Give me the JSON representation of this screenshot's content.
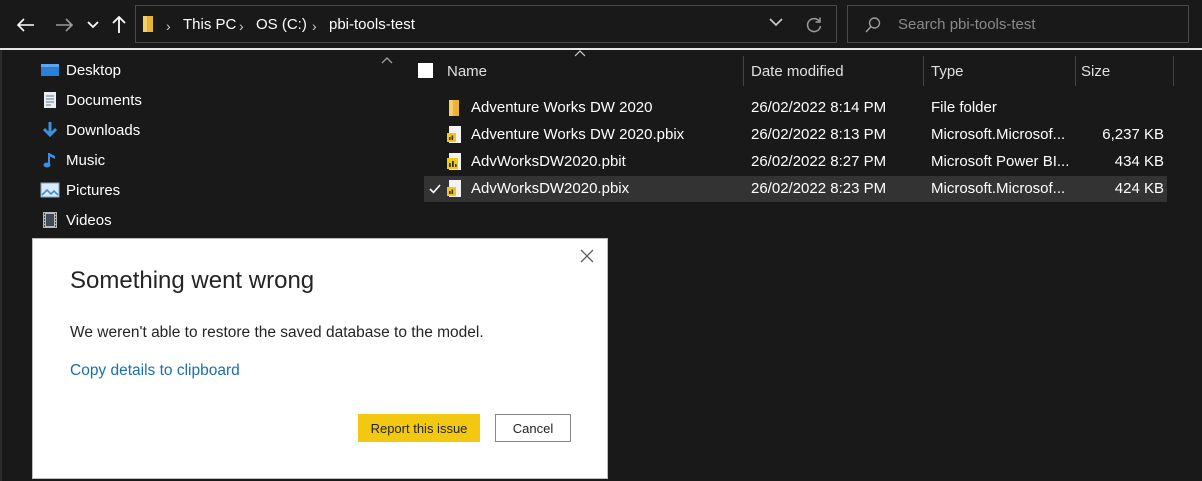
{
  "address_bar": {
    "crumbs": [
      "This PC",
      "OS (C:)",
      "pbi-tools-test"
    ],
    "search_placeholder": "Search pbi-tools-test"
  },
  "sidebar": {
    "items": [
      {
        "label": "Desktop",
        "icon": "desktop-icon"
      },
      {
        "label": "Documents",
        "icon": "documents-icon"
      },
      {
        "label": "Downloads",
        "icon": "downloads-icon"
      },
      {
        "label": "Music",
        "icon": "music-icon"
      },
      {
        "label": "Pictures",
        "icon": "pictures-icon"
      },
      {
        "label": "Videos",
        "icon": "videos-icon"
      }
    ]
  },
  "file_list": {
    "columns": [
      "Name",
      "Date modified",
      "Type",
      "Size"
    ],
    "rows": [
      {
        "name": "Adventure Works DW 2020",
        "date": "26/02/2022 8:14 PM",
        "type": "File folder",
        "size": "",
        "icon": "folder-icon",
        "selected": false
      },
      {
        "name": "Adventure Works DW 2020.pbix",
        "date": "26/02/2022 8:13 PM",
        "type": "Microsoft.Microsof...",
        "size": "6,237 KB",
        "icon": "pbix-file-icon",
        "selected": false
      },
      {
        "name": "AdvWorksDW2020.pbit",
        "date": "26/02/2022 8:27 PM",
        "type": "Microsoft Power BI...",
        "size": "434 KB",
        "icon": "pbit-file-icon",
        "selected": false
      },
      {
        "name": "AdvWorksDW2020.pbix",
        "date": "26/02/2022 8:23 PM",
        "type": "Microsoft.Microsof...",
        "size": "424 KB",
        "icon": "pbix-file-icon",
        "selected": true
      }
    ]
  },
  "dialog": {
    "title": "Something went wrong",
    "message": "We weren't able to restore the saved database to the model.",
    "link": "Copy details to clipboard",
    "primary_button": "Report this issue",
    "secondary_button": "Cancel"
  },
  "colors": {
    "background": "#191919",
    "selected_row": "#333333",
    "accent_yellow": "#f2c811",
    "link_blue": "#1a6fb0"
  }
}
